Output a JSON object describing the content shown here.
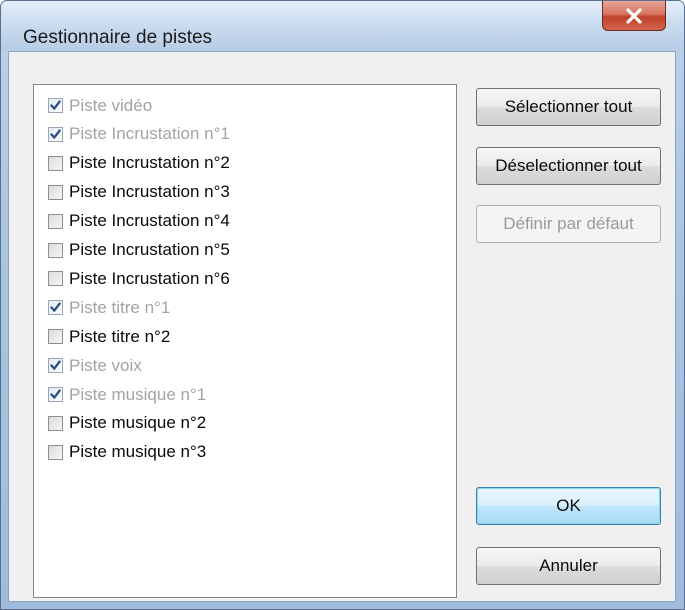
{
  "dialog": {
    "title": "Gestionnaire de pistes",
    "close_icon": "close-x-icon"
  },
  "tracks": [
    {
      "label": "Piste vidéo",
      "checked": true,
      "enabled": false
    },
    {
      "label": "Piste Incrustation n°1",
      "checked": true,
      "enabled": false
    },
    {
      "label": "Piste Incrustation n°2",
      "checked": false,
      "enabled": true
    },
    {
      "label": "Piste Incrustation n°3",
      "checked": false,
      "enabled": true
    },
    {
      "label": "Piste Incrustation n°4",
      "checked": false,
      "enabled": true
    },
    {
      "label": "Piste Incrustation n°5",
      "checked": false,
      "enabled": true
    },
    {
      "label": "Piste Incrustation n°6",
      "checked": false,
      "enabled": true
    },
    {
      "label": "Piste titre n°1",
      "checked": true,
      "enabled": false
    },
    {
      "label": "Piste titre n°2",
      "checked": false,
      "enabled": true
    },
    {
      "label": "Piste voix",
      "checked": true,
      "enabled": false
    },
    {
      "label": "Piste musique n°1",
      "checked": true,
      "enabled": false
    },
    {
      "label": "Piste musique n°2",
      "checked": false,
      "enabled": true
    },
    {
      "label": "Piste musique n°3",
      "checked": false,
      "enabled": true
    }
  ],
  "buttons": {
    "select_all": "Sélectionner tout",
    "deselect_all": "Déselectionner tout",
    "set_default": "Définir par défaut",
    "ok": "OK",
    "cancel": "Annuler"
  },
  "colors": {
    "check_mark": "#2b4e86",
    "disabled_text": "#a3a3a3",
    "default_button_border": "#3c7fb1"
  }
}
